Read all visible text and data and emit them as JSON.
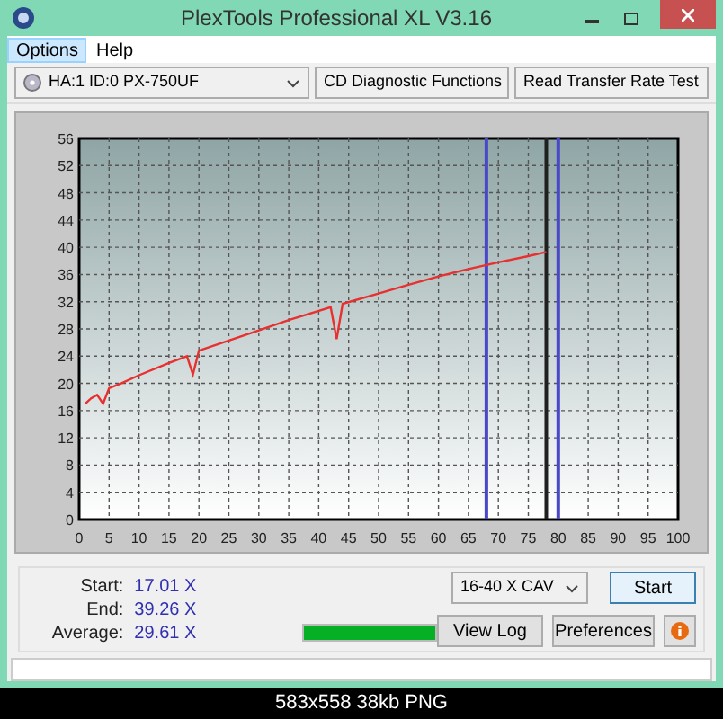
{
  "window": {
    "title": "PlexTools Professional XL V3.16"
  },
  "menu": [
    {
      "label": "Options",
      "selected": true
    },
    {
      "label": "Help",
      "selected": false
    }
  ],
  "toolbar": {
    "drive": "HA:1 ID:0  PX-750UF",
    "function": "CD Diagnostic Functions",
    "test": "Read Transfer Rate Test"
  },
  "chart_data": {
    "type": "line",
    "xlim": [
      0,
      100
    ],
    "ylim": [
      0,
      56
    ],
    "xticks": [
      0,
      5,
      10,
      15,
      20,
      25,
      30,
      35,
      40,
      45,
      50,
      55,
      60,
      65,
      70,
      75,
      80,
      85,
      90,
      95,
      100
    ],
    "yticks": [
      0,
      4,
      8,
      12,
      16,
      20,
      24,
      28,
      32,
      36,
      40,
      44,
      48,
      52,
      56
    ],
    "x": [
      1,
      2,
      3,
      4,
      5,
      7,
      10,
      15,
      18,
      19,
      20,
      25,
      30,
      35,
      42,
      43,
      44,
      50,
      55,
      60,
      65,
      70,
      75,
      78
    ],
    "grid": true,
    "series": [
      {
        "color": "#e83030",
        "values": [
          17,
          17.8,
          18.3,
          17,
          19.3,
          20,
          21.2,
          23,
          24,
          21.3,
          24.8,
          26.3,
          27.8,
          29.3,
          31.2,
          26.5,
          31.7,
          33.2,
          34.5,
          35.7,
          36.8,
          37.8,
          38.7,
          39.3
        ]
      }
    ],
    "ref_lines": [
      {
        "axis": "x",
        "value": 68,
        "color": "#4848c8"
      },
      {
        "axis": "x",
        "value": 78,
        "color": "#202020"
      },
      {
        "axis": "x",
        "value": 80,
        "color": "#4848c8"
      }
    ]
  },
  "results": [
    {
      "label": "Start:",
      "value": "17.01 X"
    },
    {
      "label": "End:",
      "value": "39.26 X"
    },
    {
      "label": "Average:",
      "value": "29.61 X"
    }
  ],
  "speed": "16-40 X CAV",
  "progress": {
    "level": 1
  },
  "buttons": {
    "start": "Start",
    "view_log": "View Log",
    "preferences": "Preferences"
  },
  "caption": "583x558 38kb PNG"
}
